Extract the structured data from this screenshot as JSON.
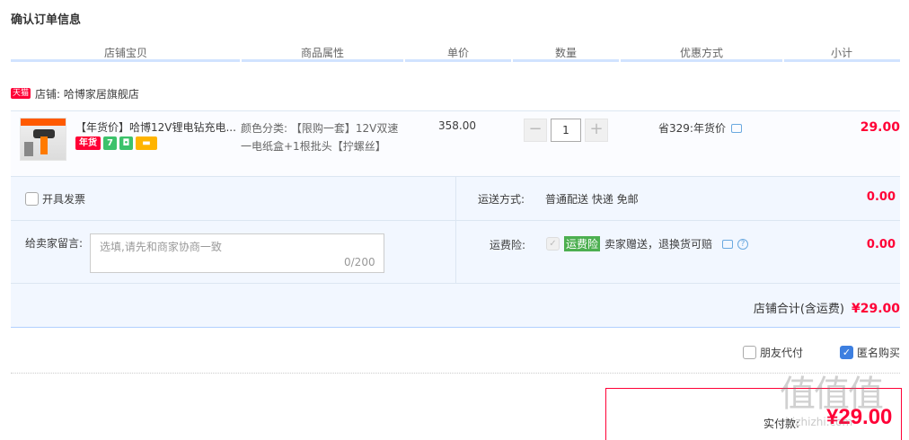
{
  "page_title": "确认订单信息",
  "columns": [
    "店铺宝贝",
    "商品属性",
    "单价",
    "数量",
    "优惠方式",
    "小计"
  ],
  "shop": {
    "badge": "天猫",
    "label": "店铺: 哈博家居旗舰店"
  },
  "item": {
    "title": "【年货价】哈博12V锂电钻充电...",
    "icon_nianhuo": "年货",
    "icon_seven": "7",
    "attr_line1": "颜色分类: 【限购一套】12V双速",
    "attr_line2": "一电纸盒+1根批头【拧螺丝】",
    "price": "358.00",
    "qty_minus": "−",
    "qty_value": "1",
    "qty_plus": "+",
    "discount": "省329:年货价",
    "subtotal": "29.00"
  },
  "invoice": {
    "label": "开具发票"
  },
  "shipping": {
    "label": "运送方式:",
    "value": "普通配送 快递 免邮",
    "amount": "0.00"
  },
  "message": {
    "label": "给卖家留言:",
    "placeholder": "选填,请先和商家协商一致",
    "count": "0/200"
  },
  "insurance": {
    "label": "运费险:",
    "badge": "运费险",
    "text": "卖家赠送，退换货可赔",
    "amount": "0.00",
    "check_mark": "✓",
    "help": "?"
  },
  "shop_total": {
    "label": "店铺合计(含运费)",
    "amount": "¥29.00"
  },
  "friend_pay": {
    "label": "朋友代付"
  },
  "anonymous": {
    "label": "匿名购买",
    "check_mark": "✓"
  },
  "pay": {
    "label": "实付款:",
    "amount": "¥29.00"
  },
  "watermark": {
    "big": "值值值",
    "small": "zhizhizhi.com"
  },
  "colors": {
    "accent": "#ff0036",
    "header_line": "#b2d1ff",
    "panel_bg": "#f2f7ff",
    "check_blue": "#3d7fe0",
    "insurance_green": "#4caf50"
  }
}
